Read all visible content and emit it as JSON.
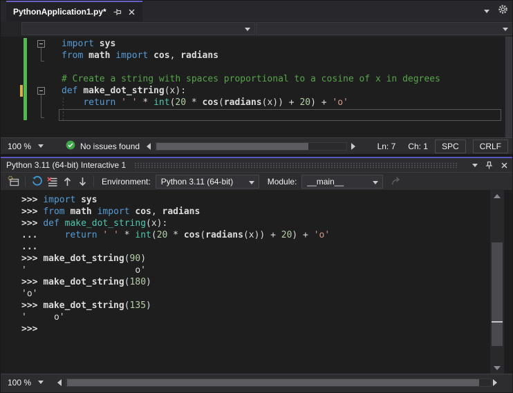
{
  "tab": {
    "title": "PythonApplication1.py*"
  },
  "icons": {
    "tab-pin": "horizontal-pin",
    "tab-close": "x",
    "tab-list-chevron": "triangle-down",
    "settings": "gear",
    "issues-ok": "green-circle-check",
    "interactive-window": "window-with-gear",
    "reset": "blue-circular-arrow",
    "clear-screen": "text-lines-with-red-x",
    "history-previous": "arrow-up",
    "history-next": "arrow-down",
    "send-to-source": "curved-arrow-disabled",
    "window-position-chevron": "triangle-down",
    "window-pin": "vertical-pin",
    "window-close": "x",
    "scroll-left": "triangle-left",
    "scroll-right": "triangle-right",
    "scroll-up": "triangle-up",
    "scroll-down": "triangle-down"
  },
  "colors": {
    "accent_tab": "#6760c6",
    "accent_interactive": "#5b57c0",
    "keyword": "#569cd6",
    "comment": "#57a64a",
    "string": "#d69d85",
    "number": "#b5cea8",
    "type": "#4ec9b0",
    "text": "#dcdcdc",
    "editor_bg": "#1e1e1e",
    "chrome_bg": "#2d2d30",
    "change_saved": "#52b84f",
    "change_unsaved": "#d9b13b",
    "issues_ok_green": "#3fa74a",
    "reset_blue": "#3f9bd8",
    "clear_red": "#e05561"
  },
  "editor": {
    "current_line": 7,
    "lines": [
      {
        "tokens": [
          {
            "c": "kw",
            "t": "import"
          },
          {
            "c": "pl",
            "t": " "
          },
          {
            "c": "id",
            "t": "sys"
          }
        ]
      },
      {
        "tokens": [
          {
            "c": "kw",
            "t": "from"
          },
          {
            "c": "pl",
            "t": " "
          },
          {
            "c": "id",
            "t": "math"
          },
          {
            "c": "pl",
            "t": " "
          },
          {
            "c": "kw",
            "t": "import"
          },
          {
            "c": "pl",
            "t": " "
          },
          {
            "c": "id",
            "t": "cos"
          },
          {
            "c": "pl",
            "t": ", "
          },
          {
            "c": "id",
            "t": "radians"
          }
        ]
      },
      {
        "tokens": []
      },
      {
        "tokens": [
          {
            "c": "cm",
            "t": "# Create a string with spaces proportional to a cosine of x in degrees"
          }
        ]
      },
      {
        "tokens": [
          {
            "c": "kw",
            "t": "def"
          },
          {
            "c": "pl",
            "t": " "
          },
          {
            "c": "fn",
            "t": "make_dot_string"
          },
          {
            "c": "pl",
            "t": "(x):"
          }
        ]
      },
      {
        "tokens": [
          {
            "c": "pl",
            "t": "    "
          },
          {
            "c": "kw",
            "t": "return"
          },
          {
            "c": "pl",
            "t": " "
          },
          {
            "c": "str",
            "t": "' '"
          },
          {
            "c": "pl",
            "t": " * "
          },
          {
            "c": "type",
            "t": "int"
          },
          {
            "c": "pl",
            "t": "("
          },
          {
            "c": "num",
            "t": "20"
          },
          {
            "c": "pl",
            "t": " * "
          },
          {
            "c": "id",
            "t": "cos"
          },
          {
            "c": "pl",
            "t": "("
          },
          {
            "c": "id",
            "t": "radians"
          },
          {
            "c": "pl",
            "t": "(x)) + "
          },
          {
            "c": "num",
            "t": "20"
          },
          {
            "c": "pl",
            "t": ") + "
          },
          {
            "c": "str",
            "t": "'o'"
          }
        ]
      },
      {
        "tokens": []
      }
    ]
  },
  "editor_status": {
    "zoom": "100 %",
    "message": "No issues found",
    "ln": "Ln: 7",
    "ch": "Ch: 1",
    "spaces": "SPC",
    "eol": "CRLF"
  },
  "interactive": {
    "title": "Python 3.11 (64-bit) Interactive 1",
    "toolbar": {
      "environment_label": "Environment:",
      "environment_value": "Python 3.11 (64-bit)",
      "module_label": "Module:",
      "module_value": "__main__"
    },
    "lines": [
      {
        "prompt": ">>>",
        "tokens": [
          {
            "c": "kw",
            "t": "import"
          },
          {
            "c": "pl",
            "t": " "
          },
          {
            "c": "id",
            "t": "sys"
          }
        ]
      },
      {
        "prompt": ">>>",
        "tokens": [
          {
            "c": "kw",
            "t": "from"
          },
          {
            "c": "pl",
            "t": " "
          },
          {
            "c": "id",
            "t": "math"
          },
          {
            "c": "pl",
            "t": " "
          },
          {
            "c": "kw",
            "t": "import"
          },
          {
            "c": "pl",
            "t": " "
          },
          {
            "c": "id",
            "t": "cos"
          },
          {
            "c": "pl",
            "t": ", "
          },
          {
            "c": "id",
            "t": "radians"
          }
        ]
      },
      {
        "prompt": ">>>",
        "tokens": [
          {
            "c": "kw",
            "t": "def"
          },
          {
            "c": "pl",
            "t": " "
          },
          {
            "c": "type",
            "t": "make_dot_string"
          },
          {
            "c": "pl",
            "t": "(x):"
          }
        ]
      },
      {
        "prompt": "...",
        "tokens": [
          {
            "c": "pl",
            "t": "    "
          },
          {
            "c": "kw",
            "t": "return"
          },
          {
            "c": "pl",
            "t": " "
          },
          {
            "c": "str",
            "t": "' '"
          },
          {
            "c": "pl",
            "t": " * "
          },
          {
            "c": "type",
            "t": "int"
          },
          {
            "c": "pl",
            "t": "("
          },
          {
            "c": "num",
            "t": "20"
          },
          {
            "c": "pl",
            "t": " * "
          },
          {
            "c": "id",
            "t": "cos"
          },
          {
            "c": "pl",
            "t": "("
          },
          {
            "c": "id",
            "t": "radians"
          },
          {
            "c": "pl",
            "t": "(x)) + "
          },
          {
            "c": "num",
            "t": "20"
          },
          {
            "c": "pl",
            "t": ") + "
          },
          {
            "c": "str",
            "t": "'o'"
          }
        ]
      },
      {
        "prompt": "...",
        "tokens": []
      },
      {
        "prompt": ">>>",
        "tokens": [
          {
            "c": "id",
            "t": "make_dot_string"
          },
          {
            "c": "pl",
            "t": "("
          },
          {
            "c": "num",
            "t": "90"
          },
          {
            "c": "pl",
            "t": ")"
          }
        ]
      },
      {
        "prompt": "",
        "tokens": [
          {
            "c": "out",
            "t": "'                    o'"
          }
        ]
      },
      {
        "prompt": ">>>",
        "tokens": [
          {
            "c": "id",
            "t": "make_dot_string"
          },
          {
            "c": "pl",
            "t": "("
          },
          {
            "c": "num",
            "t": "180"
          },
          {
            "c": "pl",
            "t": ")"
          }
        ]
      },
      {
        "prompt": "",
        "tokens": [
          {
            "c": "out",
            "t": "'o'"
          }
        ]
      },
      {
        "prompt": ">>>",
        "tokens": [
          {
            "c": "id",
            "t": "make_dot_string"
          },
          {
            "c": "pl",
            "t": "("
          },
          {
            "c": "num",
            "t": "135"
          },
          {
            "c": "pl",
            "t": ")"
          }
        ]
      },
      {
        "prompt": "",
        "tokens": [
          {
            "c": "out",
            "t": "'     o'"
          }
        ]
      },
      {
        "prompt": ">>>",
        "tokens": []
      }
    ],
    "status": {
      "zoom": "100 %"
    }
  }
}
